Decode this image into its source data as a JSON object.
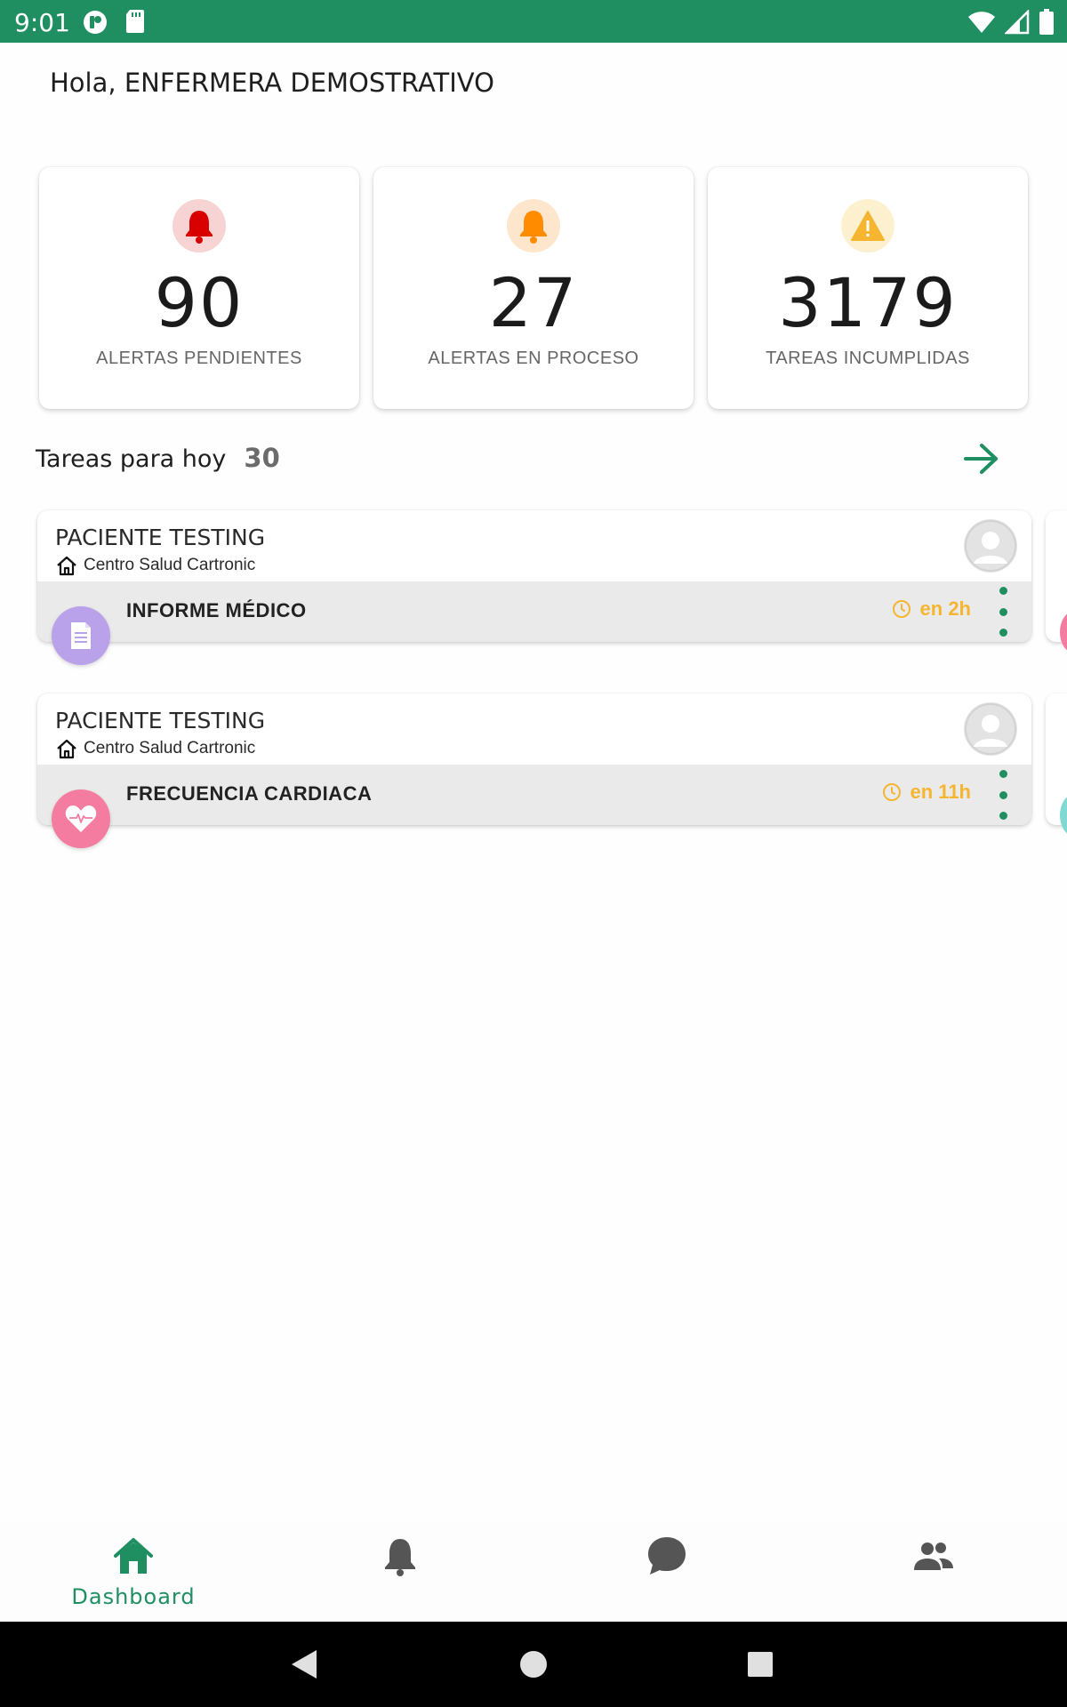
{
  "status_bar": {
    "time": "9:01"
  },
  "greeting": "Hola, ENFERMERA DEMOSTRATIVO",
  "stats": [
    {
      "value": "90",
      "label": "ALERTAS PENDIENTES",
      "icon": "bell-icon",
      "color": "#d90000",
      "bg": "#f7d3d3"
    },
    {
      "value": "27",
      "label": "ALERTAS EN PROCESO",
      "icon": "bell-icon",
      "color": "#ff8c00",
      "bg": "#fde6cc"
    },
    {
      "value": "3179",
      "label": "TAREAS INCUMPLIDAS",
      "icon": "warning-icon",
      "color": "#f5b531",
      "bg": "#fdf0cf"
    }
  ],
  "tasks": {
    "title": "Tareas para hoy",
    "count": "30",
    "items": [
      {
        "patient": "PACIENTE TESTING",
        "center": "Centro Salud Cartronic",
        "name": "INFORME MÉDICO",
        "time": "en 2h",
        "type_icon": "document-icon",
        "type_color": "#b9a2ea"
      },
      {
        "patient": "PACIENTE TESTING",
        "center": "Centro Salud Cartronic",
        "name": "FRECUENCIA CARDIACA",
        "time": "en 11h",
        "type_icon": "heart-rate-icon",
        "type_color": "#f47ca0"
      }
    ]
  },
  "bottom_nav": {
    "items": [
      {
        "label": "Dashboard",
        "icon": "home-icon",
        "active": true
      },
      {
        "label": "",
        "icon": "bell-icon",
        "active": false
      },
      {
        "label": "",
        "icon": "chat-icon",
        "active": false
      },
      {
        "label": "",
        "icon": "group-icon",
        "active": false
      }
    ]
  },
  "colors": {
    "primary": "#1f8f62",
    "warning": "#f5b531"
  }
}
